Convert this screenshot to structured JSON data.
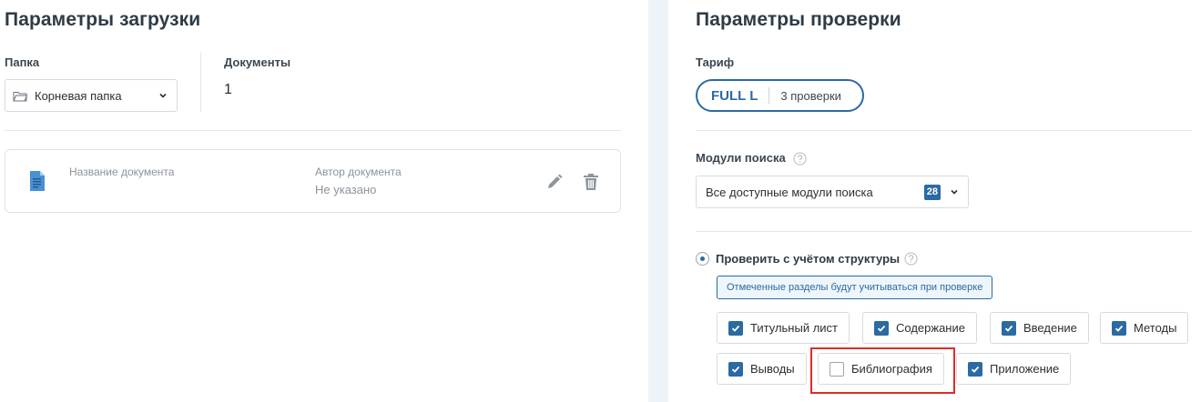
{
  "left": {
    "title": "Параметры загрузки",
    "folder": {
      "label": "Папка",
      "value": "Корневая папка"
    },
    "documents": {
      "label": "Документы",
      "count": "1"
    },
    "doc_card": {
      "name_label": "Название документа",
      "author_label": "Автор документа",
      "author_value": "Не указано"
    }
  },
  "right": {
    "title": "Параметры проверки",
    "tariff": {
      "label": "Тариф",
      "name": "FULL L",
      "checks": "3 проверки"
    },
    "modules": {
      "label": "Модули поиска",
      "value": "Все доступные модули поиска",
      "count": "28"
    },
    "structure": {
      "label": "Проверить с учётом структуры",
      "selected": true,
      "notice": "Отмеченные разделы будут учитываться при проверке",
      "sections": [
        {
          "label": "Титульный лист",
          "checked": true
        },
        {
          "label": "Содержание",
          "checked": true
        },
        {
          "label": "Введение",
          "checked": true
        },
        {
          "label": "Методы",
          "checked": true
        },
        {
          "label": "Выводы",
          "checked": true
        },
        {
          "label": "Библиография",
          "checked": false
        },
        {
          "label": "Приложение",
          "checked": true
        }
      ]
    }
  },
  "colors": {
    "accent": "#2b6aa2",
    "highlight": "#e02a2a",
    "divider": "#eef3f8"
  }
}
